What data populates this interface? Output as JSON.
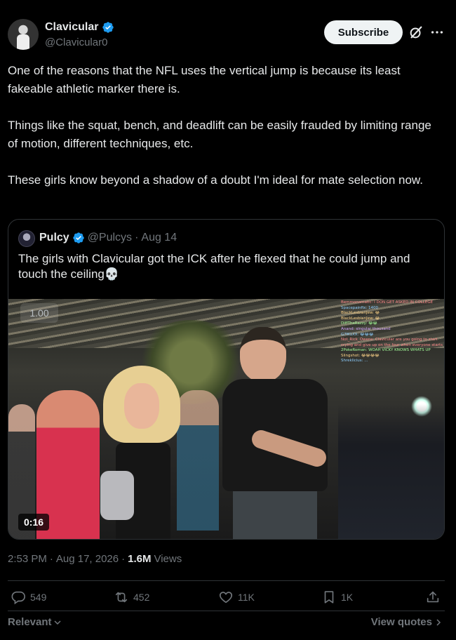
{
  "author": {
    "name": "Clavicular",
    "handle": "@Clavicular0"
  },
  "header": {
    "subscribe_label": "Subscribe"
  },
  "tweet": {
    "paragraphs": [
      "One of the reasons that the NFL uses the vertical jump is because its least fakeable athletic marker there is.",
      "Things like the squat, bench, and deadlift can be easily frauded by limiting range of motion, different techniques, etc.",
      "These girls know beyond a shadow of a doubt I'm ideal for mate selection now."
    ]
  },
  "quote": {
    "name": "Pulcy",
    "handle": "@Pulcys",
    "dot": "·",
    "date": "Aug 14",
    "text": "The girls with Clavicular got the ICK after he flexed that he could jump and touch the ceiling💀",
    "video": {
      "speed": "1.00",
      "duration": "0:16",
      "chat": [
        "Bemmonomatic: I DON GET ASKED IN COLLEGE",
        "Spacepainfix: 1400",
        "BlackLesbianJew: 😂",
        "BlackLesbianJew: 😂",
        "DiffTheRazzy: 😂😂",
        "Anand: singular thousand",
        "G7M1XX: 😂😂😂",
        "Not_Rick_Owens: Clavicular are you going to start crying and give up on the four when everyone starts mocking you?",
        "2PokeRoman: WOAH VICKY KNOWS WHATS UP",
        "Slingshot: 😂😂😂😂",
        "Shreklicius: ..."
      ]
    }
  },
  "meta": {
    "time": "2:53 PM",
    "separator": "·",
    "date": "Aug 17, 2026",
    "views_count": "1.6M",
    "views_label": "Views"
  },
  "actions": {
    "replies": "549",
    "reposts": "452",
    "likes": "11K",
    "bookmarks": "1K"
  },
  "footer": {
    "sort_label": "Relevant",
    "view_quotes_label": "View quotes"
  },
  "colors": {
    "background": "#000000",
    "text": "#e7e9ea",
    "muted": "#71767b",
    "verified": "#1d9bf0",
    "border": "#2f3336"
  }
}
